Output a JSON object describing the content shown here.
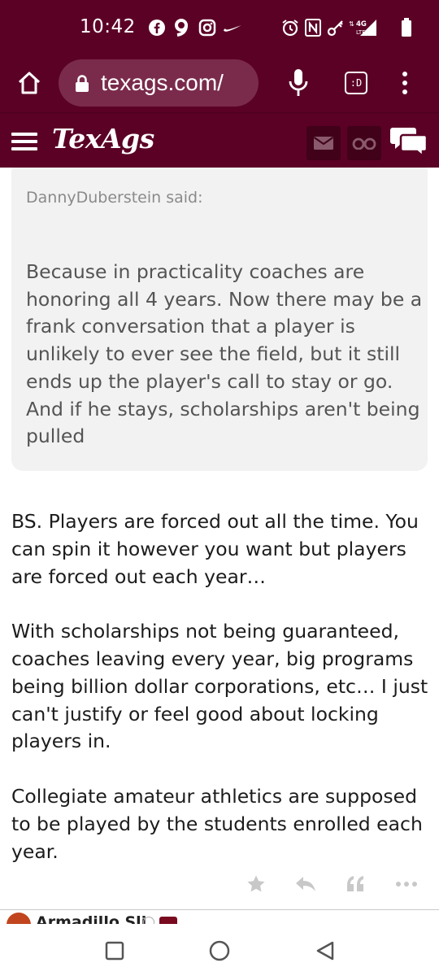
{
  "status_bar": {
    "time": "10:42",
    "network_label": "4G\nLTE",
    "left_icons": [
      "facebook-icon",
      "app-9-icon",
      "instagram-icon",
      "nike-icon"
    ],
    "right_icons": [
      "alarm-icon",
      "nfc-icon",
      "vpn-key-icon",
      "signal-icon",
      "battery-icon"
    ]
  },
  "browser": {
    "url": "texags.com/",
    "tab_switcher_label": ":D"
  },
  "site": {
    "logo_text": "TexAgs"
  },
  "quote": {
    "author_line": "DannyDuberstein said:",
    "text": "Because in practicality coaches are honoring all 4 years. Now there may be a frank conversation that a player is unlikely to ever see the field, but it still ends up the player's call to stay or go. And if he stays, scholarships aren't being pulled"
  },
  "post": {
    "paragraphs": [
      "BS. Players are forced out all the time. You can spin it however you want but players are forced out each year…",
      "With scholarships not being guaranteed, coaches leaving every year, big programs being billion dollar corporations, etc… I just can't justify or feel good about locking players in.",
      "Collegiate amateur athletics are supposed to be played by the students enrolled each year."
    ],
    "actions": [
      "star-icon",
      "reply-icon",
      "quote-icon",
      "more-icon"
    ]
  },
  "next_post": {
    "author_partial": "Armadillo Sli..."
  },
  "colors": {
    "brand_maroon": "#5b0126",
    "quote_bg": "#f2f2f2",
    "action_gray": "#c8c8c8"
  }
}
